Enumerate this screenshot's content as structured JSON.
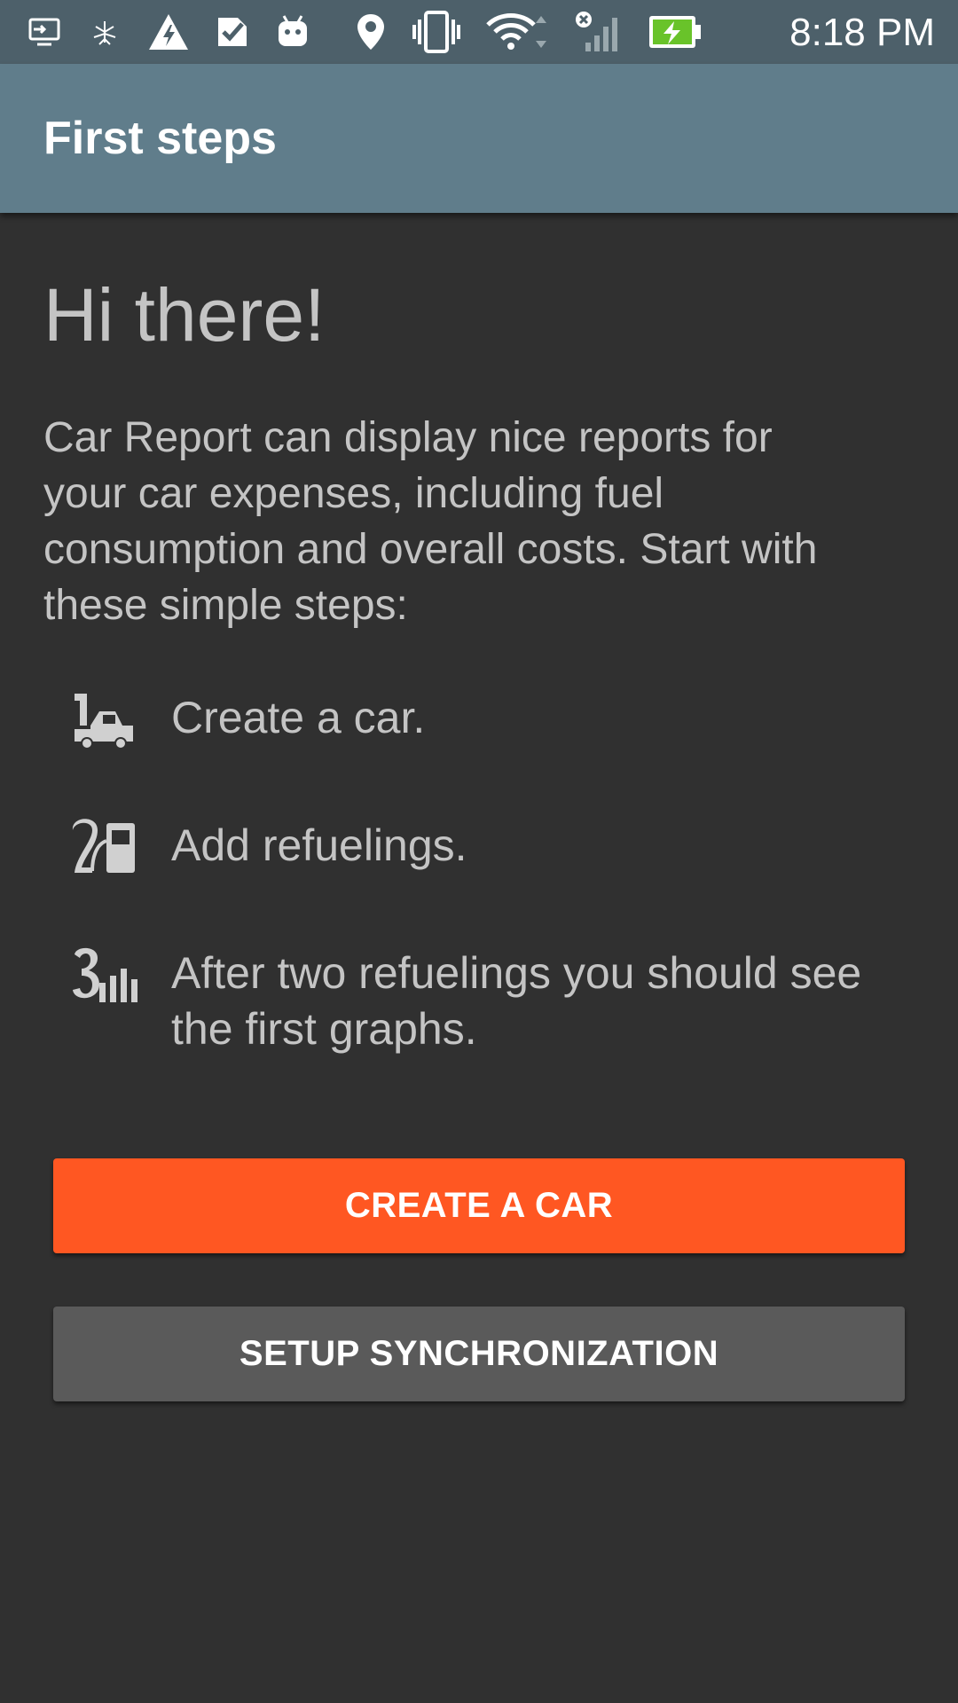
{
  "status_bar": {
    "time": "8:18 PM",
    "left_icons": [
      "screen-cast-icon",
      "bug-icon",
      "warning-icon",
      "task-check-icon",
      "android-icon"
    ],
    "right_icons": [
      "location-icon",
      "vibrate-icon",
      "wifi-icon",
      "signal-icon",
      "battery-charging-icon"
    ]
  },
  "app_bar": {
    "title": "First steps"
  },
  "main": {
    "greeting": "Hi there!",
    "intro": "Car Report can display nice reports for your car expenses, including fuel consumption and overall costs. Start with these simple steps:",
    "steps": [
      {
        "number": "1",
        "icon": "car-icon",
        "text": "Create a car."
      },
      {
        "number": "2",
        "icon": "fuel-pump-icon",
        "text": "Add refuelings."
      },
      {
        "number": "3",
        "icon": "bar-chart-icon",
        "text": "After two refuelings you should see the first graphs."
      }
    ]
  },
  "buttons": {
    "create_car": "CREATE A CAR",
    "setup_sync": "SETUP SYNCHRONIZATION"
  },
  "colors": {
    "status_bar": "#4d606a",
    "app_bar": "#607d8b",
    "background": "#303030",
    "accent": "#ff5722",
    "secondary_button": "#5a5a5a"
  }
}
